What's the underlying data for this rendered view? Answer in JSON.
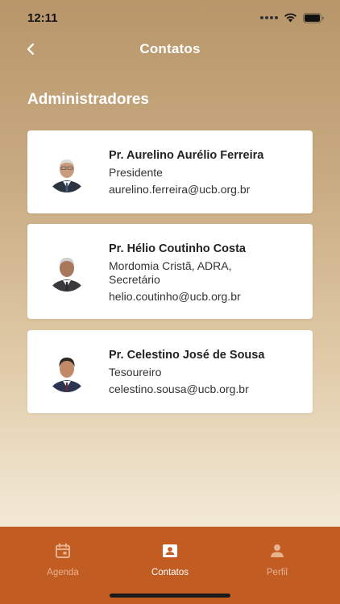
{
  "status_bar": {
    "time": "12:11"
  },
  "nav": {
    "title": "Contatos",
    "back_icon": "chevron-left-icon"
  },
  "section": {
    "title": "Administradores"
  },
  "contacts": [
    {
      "name": "Pr. Aurelino Aurélio Ferreira",
      "role": "Presidente",
      "email": "aurelino.ferreira@ucb.org.br"
    },
    {
      "name": "Pr. Hélio Coutinho Costa",
      "role": "Mordomia Cristã, ADRA, Secretário",
      "email": "helio.coutinho@ucb.org.br"
    },
    {
      "name": "Pr. Celestino José de Sousa",
      "role": "Tesoureiro",
      "email": "celestino.sousa@ucb.org.br"
    }
  ],
  "tabs": [
    {
      "label": "Agenda",
      "icon": "calendar-icon",
      "active": false
    },
    {
      "label": "Contatos",
      "icon": "contact-card-icon",
      "active": true
    },
    {
      "label": "Perfil",
      "icon": "person-icon",
      "active": false
    }
  ],
  "colors": {
    "tab_bar": "#c15c23",
    "tab_active": "#ffffff",
    "tab_inactive": "#e8b28e",
    "background_top": "#b8966a",
    "background_bottom": "#f4ecdd"
  }
}
